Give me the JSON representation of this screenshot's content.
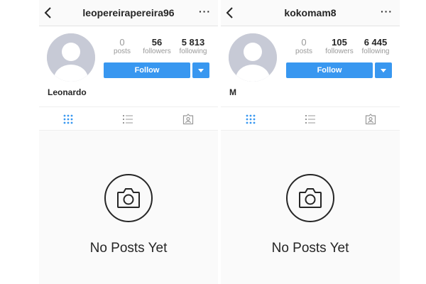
{
  "profiles": [
    {
      "username": "leopereirapereira96",
      "more_label": "···",
      "stats": [
        {
          "num": "0",
          "label": "posts"
        },
        {
          "num": "56",
          "label": "followers"
        },
        {
          "num": "5 813",
          "label": "following"
        }
      ],
      "follow_label": "Follow",
      "full_name": "Leonardo",
      "empty_label": "No Posts Yet"
    },
    {
      "username": "kokomam8",
      "more_label": "···",
      "stats": [
        {
          "num": "0",
          "label": "posts"
        },
        {
          "num": "105",
          "label": "followers"
        },
        {
          "num": "6 445",
          "label": "following"
        }
      ],
      "follow_label": "Follow",
      "full_name": "M",
      "empty_label": "No Posts Yet"
    }
  ],
  "icons": {
    "back": "chevron-left-icon",
    "grid": "grid-icon",
    "list": "list-icon",
    "tagged": "tagged-photos-icon",
    "camera": "camera-icon"
  },
  "colors": {
    "accent": "#3897f0",
    "active_tab": "#3897f0",
    "inactive_tab": "#999999"
  }
}
